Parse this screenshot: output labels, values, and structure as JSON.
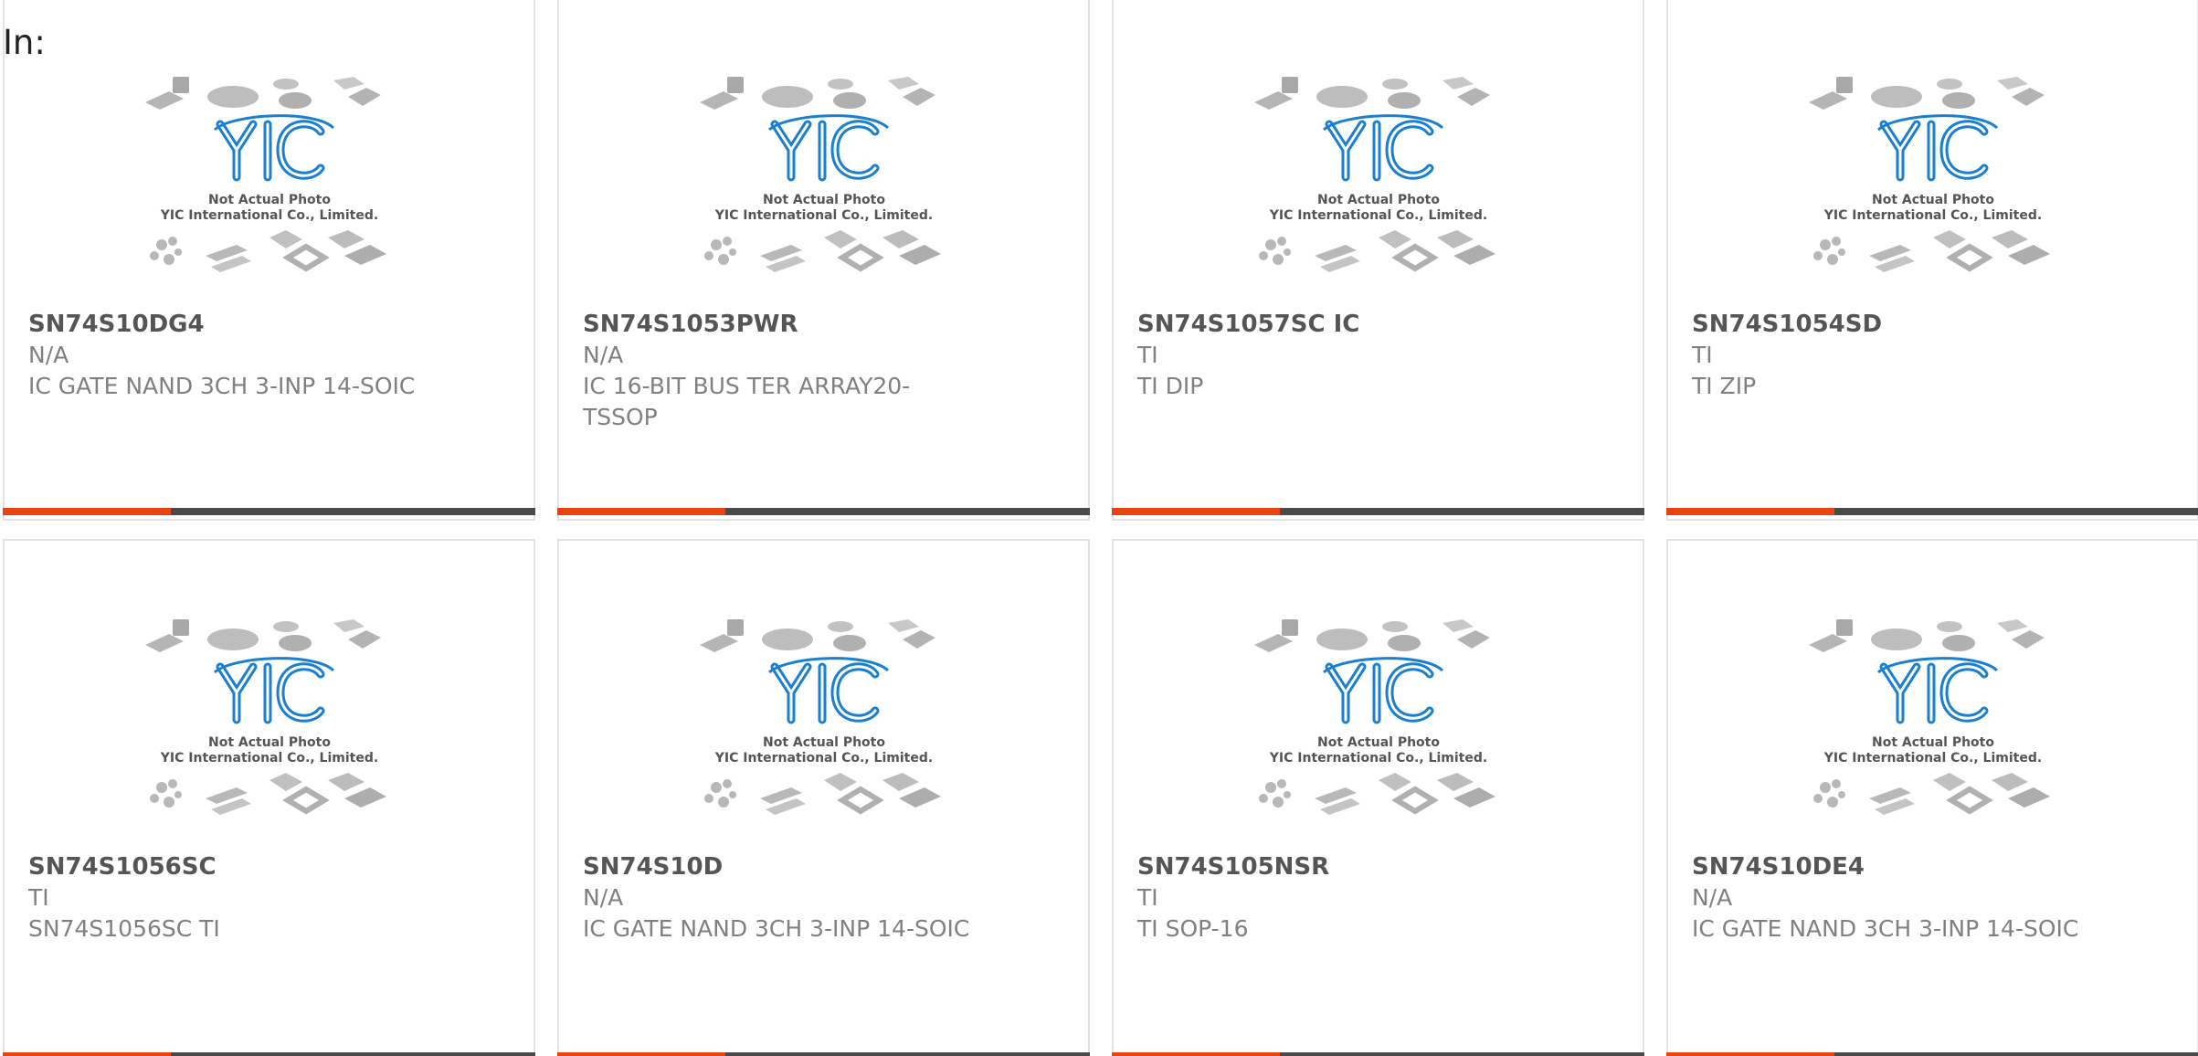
{
  "header": {
    "label": "In:"
  },
  "placeholder_image": {
    "logo_text": "YIC",
    "line1": "Not Actual Photo",
    "line2": "YIC International Co., Limited.",
    "icon": "chip-packages-placeholder"
  },
  "colors": {
    "accent": "#e8440f",
    "bar": "#4a4a4a",
    "logo_blue": "#1a7fd1",
    "chip_gray": "#b8b8b8"
  },
  "products": [
    {
      "part": "SN74S10DG4",
      "manufacturer": "N/A",
      "description": "IC GATE NAND 3CH 3-INP 14-SOIC"
    },
    {
      "part": "SN74S1053PWR",
      "manufacturer": "N/A",
      "description": "IC 16-BIT BUS TER ARRAY20-TSSOP"
    },
    {
      "part": "SN74S1057SC IC",
      "manufacturer": "TI",
      "description": "TI DIP"
    },
    {
      "part": "SN74S1054SD",
      "manufacturer": "TI",
      "description": "TI ZIP"
    },
    {
      "part": "SN74S1056SC",
      "manufacturer": "TI",
      "description": "SN74S1056SC TI"
    },
    {
      "part": "SN74S10D",
      "manufacturer": "N/A",
      "description": "IC GATE NAND 3CH 3-INP 14-SOIC"
    },
    {
      "part": "SN74S105NSR",
      "manufacturer": "TI",
      "description": "TI SOP-16"
    },
    {
      "part": "SN74S10DE4",
      "manufacturer": "N/A",
      "description": "IC GATE NAND 3CH 3-INP 14-SOIC"
    }
  ]
}
